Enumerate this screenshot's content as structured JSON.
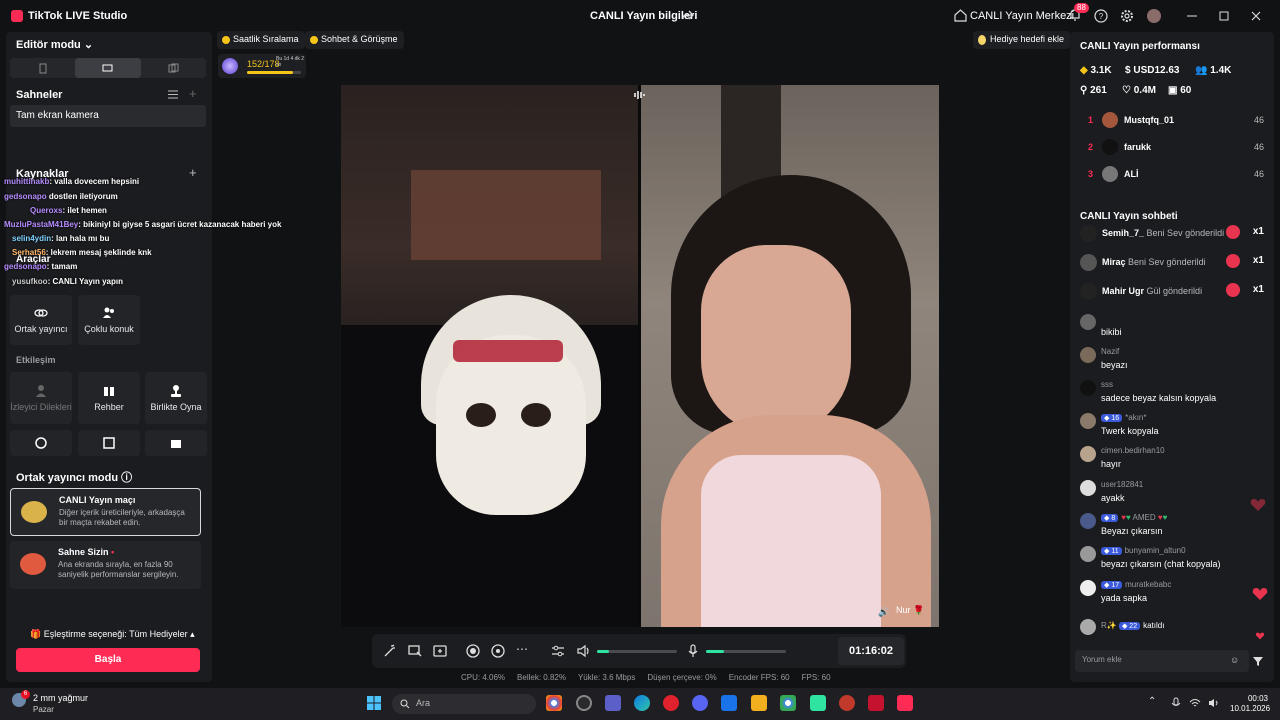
{
  "titlebar": {
    "app_name": "TikTok LIVE Studio",
    "center_title": "CANLI Yayın bilgileri",
    "live_center": "CANLI Yayın Merkezi",
    "notification_count": "88"
  },
  "left": {
    "editor_mode": "Editör modu",
    "scenes_title": "Sahneler",
    "scene_item": "Tam ekran kamera",
    "sources_title": "Kaynaklar",
    "tools_title": "Araçlar",
    "tools_hint": "CANLI Yayın yapın",
    "tiles": [
      "Ortak yayıncı",
      "Çoklu konuk"
    ],
    "interaction_title": "Etkileşim",
    "interaction_tiles": [
      "İzleyici Dilekleri",
      "Rehber",
      "Birlikte Oyna"
    ],
    "cohost_title": "Ortak yayıncı modu",
    "cards": [
      {
        "title": "CANLI Yayın maçı",
        "desc": "Diğer içerik üreticileriyle, arkadaşça bir maçta rekabet edin."
      },
      {
        "title": "Sahne Sizin",
        "desc": "Ana ekranda sırayla, en fazla 90 saniyelik performanslar sergileyin."
      }
    ],
    "matching": "Eşleştirme seçeneği: Tüm Hediyeler",
    "pair_button": "Başla"
  },
  "overlay_chat": [
    {
      "user": "muhittinakb",
      "msg": ": valla dovecem hepsini"
    },
    {
      "user": "gedsonapo",
      "msg": " dostlen iletiyorum"
    },
    {
      "user": "Queroxs",
      "msg": ": ilet hemen"
    },
    {
      "user": "MuzluPastaM41Bey",
      "msg": ": bikiniyl bi giyse 5 asgari ücret kazanacak haberi yok"
    },
    {
      "user": "selin4ydin",
      "msg": ": lan hala mı bu"
    },
    {
      "user": "Serhat56",
      "msg": ": lekrem mesaj şeklinde knk"
    },
    {
      "user": "gedsonapo",
      "msg": ": tamam"
    },
    {
      "user": "yusufkoo",
      "msg": ": CANLI Yayın yapın"
    }
  ],
  "center": {
    "pills": [
      "Saatlik Sıralama",
      "Sohbet & Görüşme"
    ],
    "level_text": "152/178",
    "level_sub": "Bu 1d 4 dk 2 sn",
    "level_progress": 0.85,
    "gift_goal": "Hediye hedefi ekle",
    "guest_name": "Nur",
    "timer": "01:16:02",
    "mic_level": 0.22,
    "volume_level": 0.15,
    "stats": [
      "CPU: 4.06%",
      "Bellek: 0.82%",
      "Yükle: 3.6 Mbps",
      "Düşen çerçeve: 0%",
      "Encoder FPS: 60",
      "FPS: 60"
    ]
  },
  "right": {
    "perf_title": "CANLI Yayın performansı",
    "metrics": [
      "3.1K",
      "USD12.63",
      "1.4K",
      "261",
      "0.4M",
      "60"
    ],
    "ranks": [
      {
        "rank": "1",
        "name": "Mustqfq_01",
        "score": "46"
      },
      {
        "rank": "2",
        "name": "farukk",
        "score": "46"
      },
      {
        "rank": "3",
        "name": "ALİ",
        "score": "46"
      }
    ],
    "chat_title": "CANLI Yayın sohbeti",
    "gifts": [
      {
        "user": "Semih_7_",
        "action": "Beni Sev gönderildi",
        "count": "x1"
      },
      {
        "user": "Miraç",
        "action": "Beni Sev gönderildi",
        "count": "x1"
      },
      {
        "user": "Mahir Ugr",
        "action": "Gül gönderildi",
        "count": "x1"
      }
    ],
    "messages": [
      {
        "user": "",
        "level": "",
        "text": "bikibi"
      },
      {
        "user": "Nazif",
        "level": "",
        "text": "beyazı"
      },
      {
        "user": "sss",
        "level": "",
        "text": "sadece beyaz kalsın kopyala"
      },
      {
        "user": "*akın*",
        "level": "16",
        "text": "Twerk kopyala"
      },
      {
        "user": "cimen.bedirhan10",
        "level": "",
        "text": "hayır"
      },
      {
        "user": "user182841",
        "level": "",
        "text": "ayakk"
      },
      {
        "user": "AMED",
        "level": "8",
        "text": "Beyazı çıkarsın"
      },
      {
        "user": "bunyamin_altun0",
        "level": "11",
        "text": "beyazı çıkarsın (chat kopyala)"
      },
      {
        "user": "muratkebabc",
        "level": "17",
        "text": "yada sapka"
      },
      {
        "user": "R",
        "level": "22",
        "text": "katıldı"
      }
    ],
    "input_placeholder": "Yorum ekle"
  },
  "taskbar": {
    "weather_temp": "2 mm yağmur",
    "weather_desc": "Pazar",
    "weather_badge": "6",
    "search_placeholder": "Ara",
    "time": "00:03",
    "date": "10.01.2026"
  }
}
